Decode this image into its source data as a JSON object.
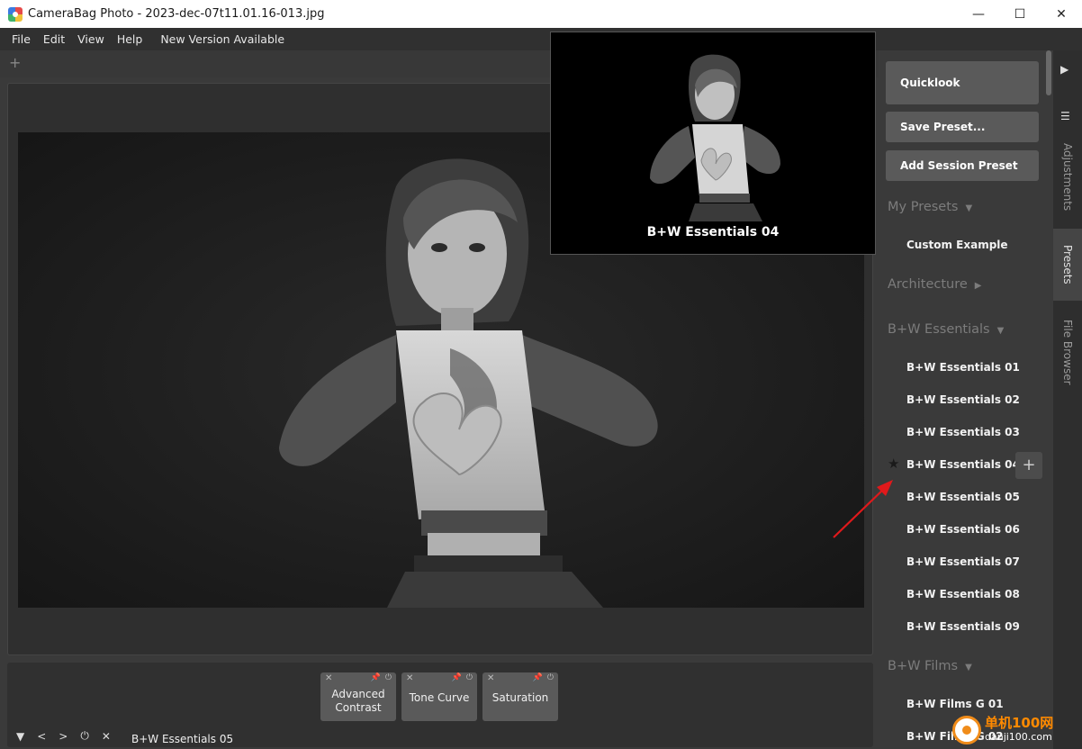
{
  "window": {
    "title": "CameraBag Photo - 2023-dec-07t11.01.16-013.jpg",
    "minimize": "—",
    "maximize": "☐",
    "close": "✕"
  },
  "menu": {
    "items": [
      "File",
      "Edit",
      "View",
      "Help"
    ],
    "new_version": "New Version Available"
  },
  "tabs": {
    "add": "+"
  },
  "preview": {
    "label": "B+W Essentials 04"
  },
  "adjustments": [
    {
      "label_line1": "Advanced",
      "label_line2": "Contrast"
    },
    {
      "label": "Tone Curve"
    },
    {
      "label": "Saturation"
    }
  ],
  "chip_glyphs": {
    "close": "✕",
    "pin": "📌",
    "power": "⏻"
  },
  "bottom_bar": {
    "collapse": "▼",
    "prev": "<",
    "next": ">",
    "power": "⏻",
    "clear": "✕",
    "current_preset": "B+W Essentials 05"
  },
  "side_panel": {
    "quicklook": "Quicklook",
    "save_preset": "Save Preset...",
    "add_session_preset": "Add Session Preset",
    "sections": {
      "my_presets": {
        "title": "My Presets",
        "arrow": "▼",
        "items": [
          "Custom Example"
        ]
      },
      "architecture": {
        "title": "Architecture",
        "arrow": "▶"
      },
      "bw_essentials": {
        "title": "B+W Essentials",
        "arrow": "▼",
        "items": [
          "B+W Essentials 01",
          "B+W Essentials 02",
          "B+W Essentials 03",
          "B+W Essentials 04",
          "B+W Essentials 05",
          "B+W Essentials 06",
          "B+W Essentials 07",
          "B+W Essentials 08",
          "B+W Essentials 09"
        ]
      },
      "bw_films": {
        "title": "B+W Films",
        "arrow": "▼",
        "items": [
          "B+W Films G 01",
          "B+W Films G 02"
        ]
      }
    },
    "star": "★",
    "add": "+"
  },
  "side_tabs": {
    "expand": "▶",
    "menu": "☰",
    "adjustments": "Adjustments",
    "presets": "Presets",
    "file_browser": "File Browser",
    "active": "Presets"
  },
  "watermark": {
    "big": "单机100网",
    "small": "danji100.com"
  },
  "colors": {
    "annotation_arrow": "#e0191b",
    "watermark_orange": "#ff8a00"
  }
}
